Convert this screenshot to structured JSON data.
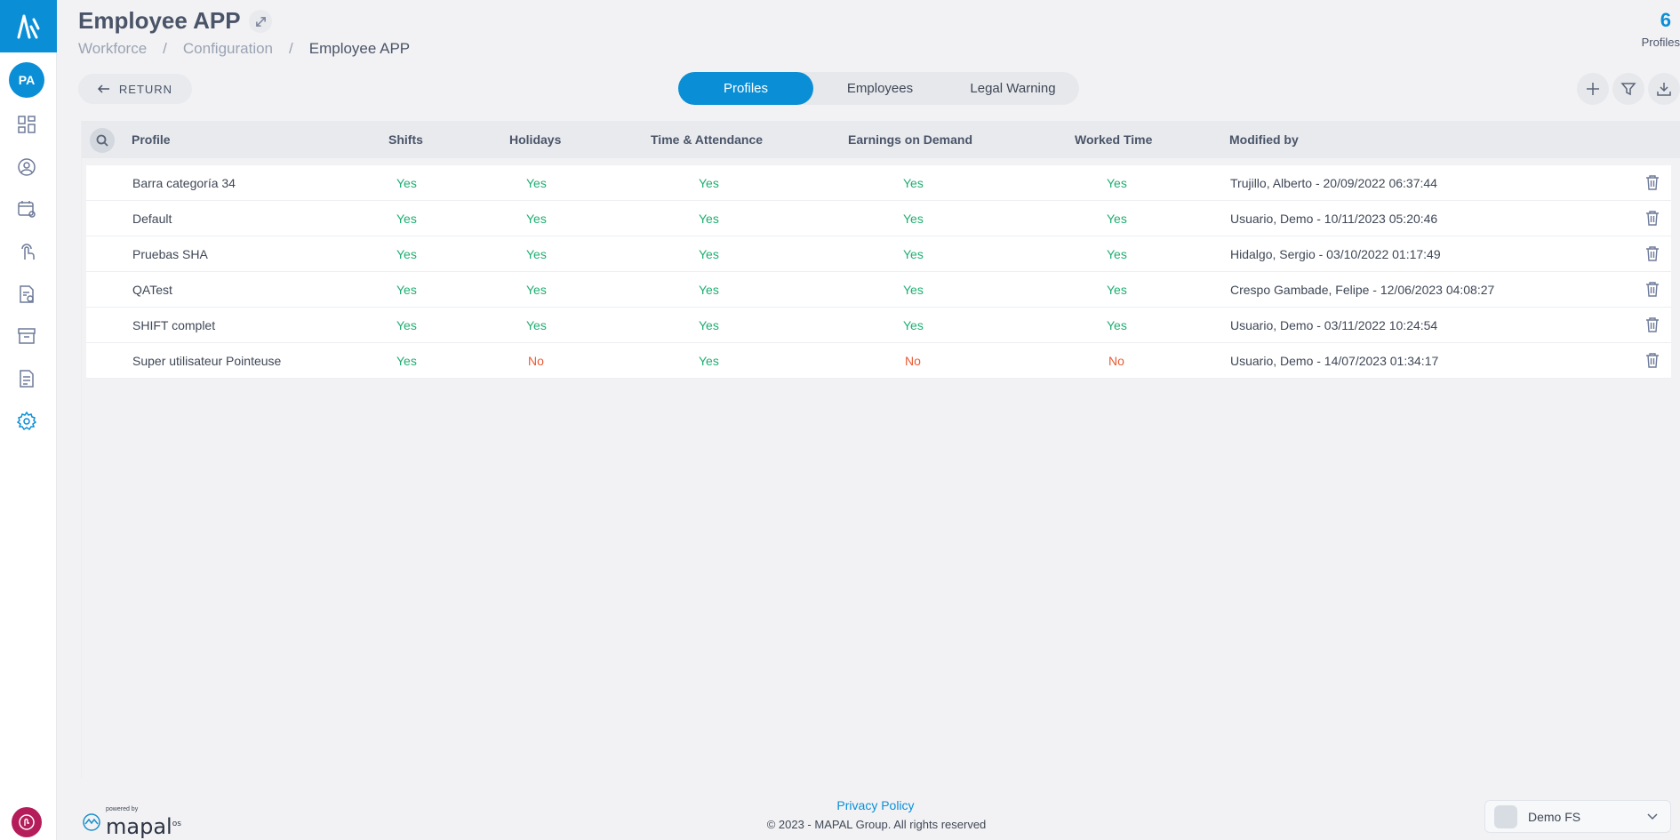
{
  "header": {
    "title": "Employee APP",
    "breadcrumb": [
      "Workforce",
      "Configuration",
      "Employee APP"
    ],
    "count": "6",
    "count_label": "Profiles"
  },
  "user": {
    "initials": "PA"
  },
  "toolbar": {
    "return_label": "RETURN",
    "tabs": [
      {
        "label": "Profiles",
        "active": true
      },
      {
        "label": "Employees",
        "active": false
      },
      {
        "label": "Legal Warning",
        "active": false
      }
    ]
  },
  "table": {
    "columns": [
      "Profile",
      "Shifts",
      "Holidays",
      "Time & Attendance",
      "Earnings on Demand",
      "Worked Time",
      "Modified by"
    ],
    "rows": [
      {
        "profile": "Barra categoría 34",
        "shifts": "Yes",
        "holidays": "Yes",
        "time_attendance": "Yes",
        "earnings": "Yes",
        "worked_time": "Yes",
        "modified_by": "Trujillo, Alberto - 20/09/2022 06:37:44"
      },
      {
        "profile": "Default",
        "shifts": "Yes",
        "holidays": "Yes",
        "time_attendance": "Yes",
        "earnings": "Yes",
        "worked_time": "Yes",
        "modified_by": "Usuario, Demo - 10/11/2023 05:20:46"
      },
      {
        "profile": "Pruebas SHA",
        "shifts": "Yes",
        "holidays": "Yes",
        "time_attendance": "Yes",
        "earnings": "Yes",
        "worked_time": "Yes",
        "modified_by": "Hidalgo, Sergio - 03/10/2022 01:17:49"
      },
      {
        "profile": "QATest",
        "shifts": "Yes",
        "holidays": "Yes",
        "time_attendance": "Yes",
        "earnings": "Yes",
        "worked_time": "Yes",
        "modified_by": "Crespo Gambade, Felipe - 12/06/2023 04:08:27"
      },
      {
        "profile": "SHIFT complet",
        "shifts": "Yes",
        "holidays": "Yes",
        "time_attendance": "Yes",
        "earnings": "Yes",
        "worked_time": "Yes",
        "modified_by": "Usuario, Demo - 03/11/2022 10:24:54"
      },
      {
        "profile": "Super utilisateur Pointeuse",
        "shifts": "Yes",
        "holidays": "No",
        "time_attendance": "Yes",
        "earnings": "No",
        "worked_time": "No",
        "modified_by": "Usuario, Demo - 14/07/2023 01:34:17"
      }
    ]
  },
  "footer": {
    "powered_by": "powered by",
    "brand": "mapal",
    "brand_sup": "os",
    "privacy": "Privacy Policy",
    "copyright": "© 2023 - MAPAL Group. All rights reserved",
    "org": "Demo FS"
  },
  "colors": {
    "accent": "#0a8fd6",
    "yes": "#1fae72",
    "no": "#ea5a33",
    "badge": "#b51d5a"
  }
}
